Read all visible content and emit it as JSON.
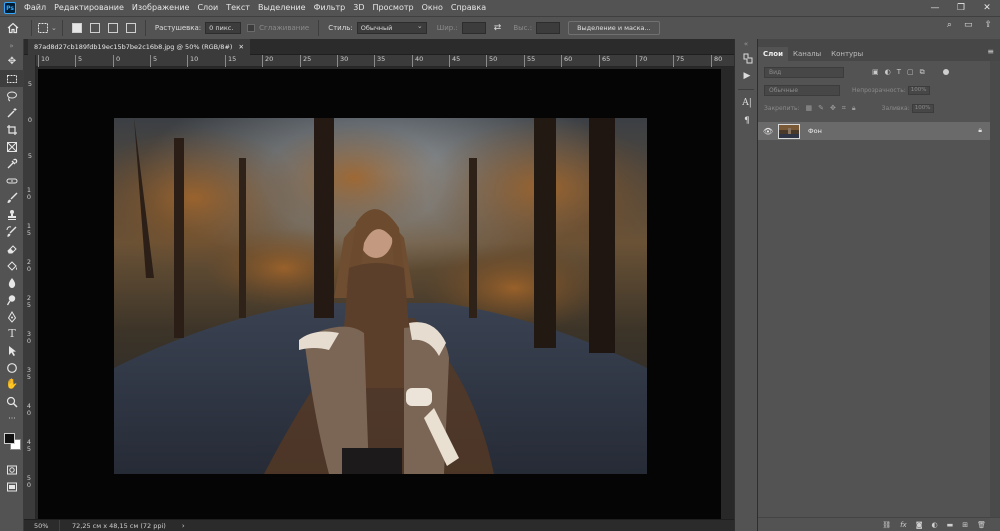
{
  "menubar": {
    "logo": "Ps",
    "items": [
      "Файл",
      "Редактирование",
      "Изображение",
      "Слои",
      "Текст",
      "Выделение",
      "Фильтр",
      "3D",
      "Просмотр",
      "Окно",
      "Справка"
    ],
    "window_controls": [
      "—",
      "❐",
      "✕"
    ]
  },
  "options": {
    "feather_label": "Растушевка:",
    "feather_value": "0 пикс.",
    "antialias_label": "Сглаживание",
    "style_label": "Стиль:",
    "style_value": "Обычный",
    "width_label": "Шир.:",
    "height_label": "Выс.:",
    "mask_button": "Выделение и маска..."
  },
  "document": {
    "tab_title": "87ad8d27cb189fdb19ec15b7be2c16b8.jpg @ 50% (RGB/8#)",
    "tab_close": "✕"
  },
  "ruler": {
    "h_labels": [
      "10",
      "5",
      "0",
      "5",
      "10",
      "15",
      "20",
      "25",
      "30",
      "35",
      "40",
      "45",
      "50",
      "55",
      "60",
      "65",
      "70",
      "75",
      "80"
    ],
    "v_labels": [
      "5",
      "0",
      "5",
      "1 0",
      "1 5",
      "2 0",
      "2 5",
      "3 0",
      "3 5",
      "4 0",
      "4 5",
      "5 0"
    ]
  },
  "status": {
    "zoom": "50%",
    "doc_size": "72,25 см x 48,15 см (72 ppi)",
    "arrow": "›"
  },
  "layers_panel": {
    "tabs": [
      "Слои",
      "Каналы",
      "Контуры"
    ],
    "menu_icon": "≡",
    "filter_placeholder": "Вид",
    "blend_mode": "Обычные",
    "opacity_label": "Непрозрачность:",
    "opacity_value": "100%",
    "lock_label": "Закрепить:",
    "fill_label": "Заливка:",
    "fill_value": "100%",
    "layers": [
      {
        "name": "Фон",
        "visible": true,
        "locked": true
      }
    ]
  },
  "icons": {
    "home": "home-icon",
    "search": "search-icon",
    "workspace": "workspace-icon",
    "share": "share-icon"
  },
  "colors": {
    "foreground": "#111111",
    "background": "#ffffff",
    "accent": "#31a8ff"
  }
}
